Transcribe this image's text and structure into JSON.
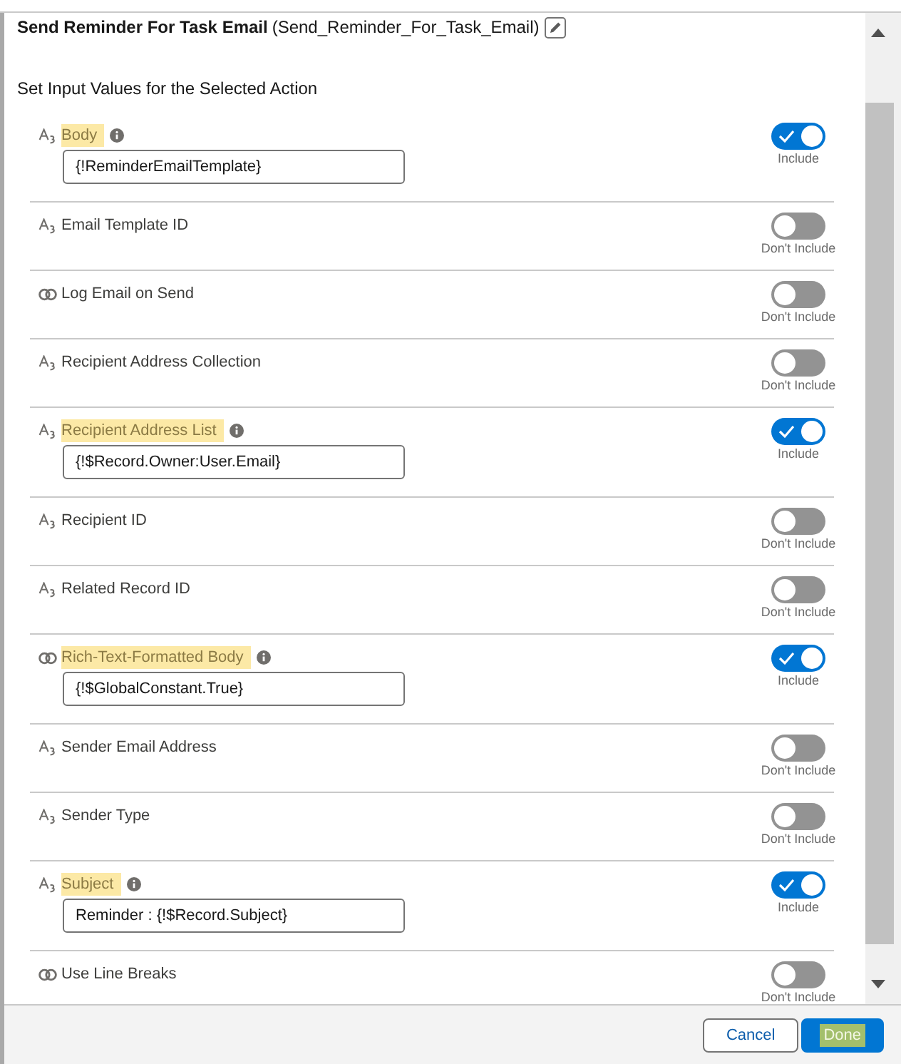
{
  "header": {
    "title": "Send Reminder For Task Email",
    "api_name": "(Send_Reminder_For_Task_Email)"
  },
  "section_title": "Set Input Values for the Selected Action",
  "fields": [
    {
      "kind": "text",
      "label": "Body",
      "highlighted": true,
      "included": true,
      "value": "{!ReminderEmailTemplate}",
      "toggle_label": "Include"
    },
    {
      "kind": "text",
      "label": "Email Template ID",
      "highlighted": false,
      "included": false,
      "toggle_label": "Don't Include"
    },
    {
      "kind": "boolean",
      "label": "Log Email on Send",
      "highlighted": false,
      "included": false,
      "toggle_label": "Don't Include"
    },
    {
      "kind": "text",
      "label": "Recipient Address Collection",
      "highlighted": false,
      "included": false,
      "toggle_label": "Don't Include"
    },
    {
      "kind": "text",
      "label": "Recipient Address List",
      "highlighted": true,
      "included": true,
      "value": "{!$Record.Owner:User.Email}",
      "toggle_label": "Include"
    },
    {
      "kind": "text",
      "label": "Recipient ID",
      "highlighted": false,
      "included": false,
      "toggle_label": "Don't Include"
    },
    {
      "kind": "text",
      "label": "Related Record ID",
      "highlighted": false,
      "included": false,
      "toggle_label": "Don't Include"
    },
    {
      "kind": "boolean",
      "label": "Rich-Text-Formatted Body",
      "highlighted": true,
      "included": true,
      "value": "{!$GlobalConstant.True}",
      "toggle_label": "Include"
    },
    {
      "kind": "text",
      "label": "Sender Email Address",
      "highlighted": false,
      "included": false,
      "toggle_label": "Don't Include"
    },
    {
      "kind": "text",
      "label": "Sender Type",
      "highlighted": false,
      "included": false,
      "toggle_label": "Don't Include"
    },
    {
      "kind": "text",
      "label": "Subject",
      "highlighted": true,
      "included": true,
      "value": "Reminder : {!$Record.Subject}",
      "toggle_label": "Include"
    },
    {
      "kind": "boolean",
      "label": "Use Line Breaks",
      "highlighted": false,
      "included": false,
      "toggle_label": "Don't Include"
    }
  ],
  "buttons": [
    {
      "label": "Cancel",
      "kind": "secondary",
      "highlighted": false
    },
    {
      "label": "Done",
      "kind": "primary",
      "highlighted": true
    }
  ]
}
